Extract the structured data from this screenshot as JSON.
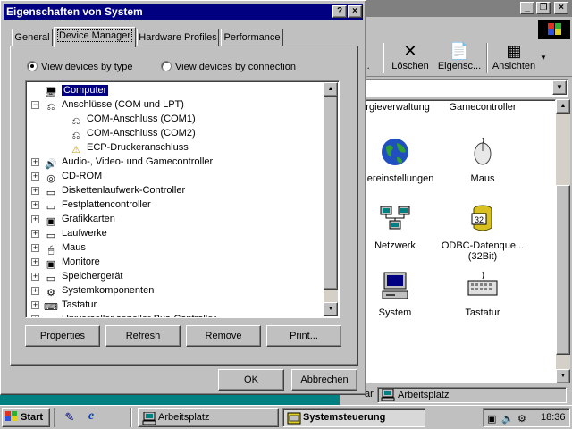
{
  "background_window": {
    "toolbar": {
      "partial_label": "ä...",
      "delete_label": "Löschen",
      "properties_label": "Eigensc...",
      "views_label": "Ansichten"
    },
    "partial_row_labels": [
      "ergieverwaltung",
      "Gamecontroller"
    ],
    "items": [
      {
        "label": "ndereinstellungen",
        "icon": "globe-icon"
      },
      {
        "label": "Maus",
        "icon": "mouse-icon"
      },
      {
        "label": "Netzwerk",
        "icon": "network-icon"
      },
      {
        "label": "ODBC-Datenque... (32Bit)",
        "icon": "odbc-icon"
      },
      {
        "label": "System",
        "icon": "computer-icon"
      },
      {
        "label": "Tastatur",
        "icon": "keyboard-icon"
      }
    ],
    "status_partial": "ar",
    "status_label": "Arbeitsplatz"
  },
  "dialog": {
    "title": "Eigenschaften von System",
    "help_label": "?",
    "close_label": "×",
    "tabs": [
      {
        "label": "General",
        "active": false
      },
      {
        "label": "Device Manager",
        "active": true
      },
      {
        "label": "Hardware Profiles",
        "active": false
      },
      {
        "label": "Performance",
        "active": false
      }
    ],
    "view_by_type_label": "View devices by type",
    "view_by_connection_label": "View devices by connection",
    "view_by_type_selected": true,
    "tree": [
      {
        "label": "Computer",
        "depth": 0,
        "selected": true,
        "icon": "computer-icon",
        "expander": ""
      },
      {
        "label": "Anschlüsse (COM und LPT)",
        "depth": 0,
        "icon": "port-icon",
        "expander": "−"
      },
      {
        "label": "COM-Anschluss (COM1)",
        "depth": 1,
        "icon": "port-icon",
        "expander": ""
      },
      {
        "label": "COM-Anschluss (COM2)",
        "depth": 1,
        "icon": "port-icon",
        "expander": ""
      },
      {
        "label": "ECP-Druckeranschluss",
        "depth": 1,
        "icon": "warning-port-icon",
        "expander": ""
      },
      {
        "label": "Audio-, Video- und Gamecontroller",
        "depth": 0,
        "icon": "speaker-icon",
        "expander": "+"
      },
      {
        "label": "CD-ROM",
        "depth": 0,
        "icon": "cdrom-icon",
        "expander": "+"
      },
      {
        "label": "Diskettenlaufwerk-Controller",
        "depth": 0,
        "icon": "controller-icon",
        "expander": "+"
      },
      {
        "label": "Festplattencontroller",
        "depth": 0,
        "icon": "controller-icon",
        "expander": "+"
      },
      {
        "label": "Grafikkarten",
        "depth": 0,
        "icon": "display-icon",
        "expander": "+"
      },
      {
        "label": "Laufwerke",
        "depth": 0,
        "icon": "drive-icon",
        "expander": "+"
      },
      {
        "label": "Maus",
        "depth": 0,
        "icon": "mouse-icon",
        "expander": "+"
      },
      {
        "label": "Monitore",
        "depth": 0,
        "icon": "monitor-icon",
        "expander": "+"
      },
      {
        "label": "Speichergerät",
        "depth": 0,
        "icon": "storage-icon",
        "expander": "+"
      },
      {
        "label": "Systemkomponenten",
        "depth": 0,
        "icon": "system-icon",
        "expander": "+"
      },
      {
        "label": "Tastatur",
        "depth": 0,
        "icon": "keyboard-icon",
        "expander": "+"
      },
      {
        "label": "Universeller serieller Bus-Controller",
        "depth": 0,
        "icon": "usb-icon",
        "expander": "+"
      }
    ],
    "buttons": {
      "properties": "Properties",
      "refresh": "Refresh",
      "remove": "Remove",
      "print": "Print...",
      "ok": "OK",
      "cancel": "Abbrechen"
    }
  },
  "taskbar": {
    "start_label": "Start",
    "tasks": [
      {
        "label": "Arbeitsplatz",
        "active": false,
        "icon": "computer-icon"
      },
      {
        "label": "Systemsteuerung",
        "active": true,
        "icon": "control-panel-icon"
      }
    ],
    "clock": "18:36"
  }
}
